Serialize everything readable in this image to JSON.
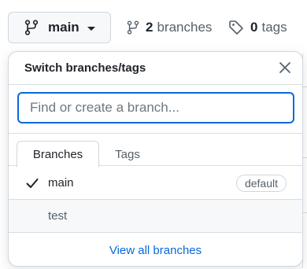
{
  "top_bar": {
    "current_branch": "main",
    "branches_count": "2",
    "branches_label": "branches",
    "tags_count": "0",
    "tags_label": "tags"
  },
  "popup": {
    "title": "Switch branches/tags",
    "search_placeholder": "Find or create a branch...",
    "tabs": [
      {
        "label": "Branches",
        "active": true
      },
      {
        "label": "Tags",
        "active": false
      }
    ],
    "branches": [
      {
        "name": "main",
        "selected": true,
        "badge": "default"
      },
      {
        "name": "test",
        "selected": false
      }
    ],
    "view_all_label": "View all branches"
  },
  "icons": {
    "branch": "git-branch-icon",
    "tag": "tag-icon",
    "close": "close-icon",
    "check": "check-icon",
    "caret": "caret-down-icon"
  },
  "colors": {
    "accent": "#0969da",
    "border": "#d0d7de",
    "muted_text": "#57606a",
    "text": "#1f2328",
    "hover_bg": "#f6f8fa"
  }
}
